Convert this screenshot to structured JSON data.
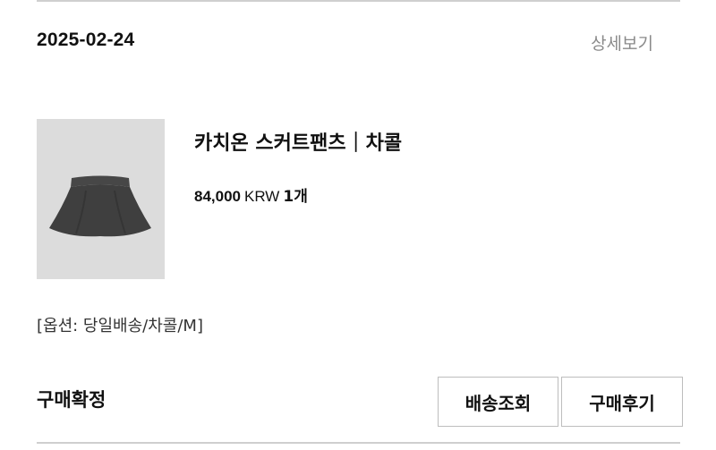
{
  "order": {
    "date": "2025-02-24",
    "detail_link": "상세보기"
  },
  "product": {
    "name": "카치온 스커트팬츠｜차콜",
    "price": "84,000",
    "currency": "KRW",
    "quantity": "1개",
    "option": "[옵션: 당일배송/차콜/M]",
    "image_icon": "skirt-product-photo"
  },
  "status": {
    "label": "구매확정"
  },
  "actions": {
    "track_label": "배송조회",
    "review_label": "구매후기"
  },
  "colors": {
    "image_bg": "#dcdcdc",
    "product_fill": "#3f3f3f",
    "muted_text": "#8a8a8a",
    "border": "#bdbdbd"
  }
}
